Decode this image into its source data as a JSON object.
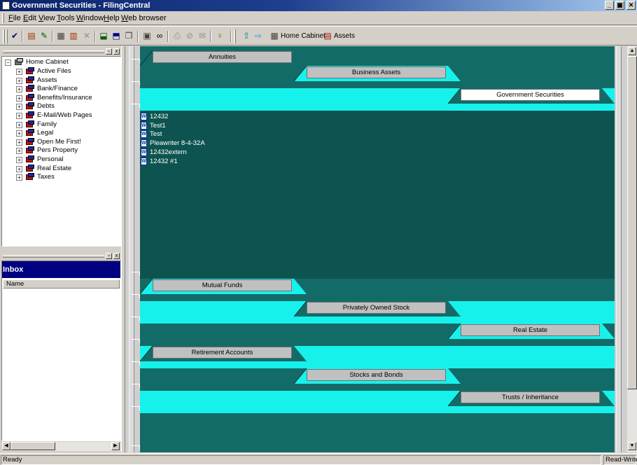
{
  "window": {
    "title": "Government Securities - FilingCentral",
    "controls": {
      "minimize": "_",
      "maximize": "▣",
      "close": "✕"
    }
  },
  "menu": [
    "File",
    "Edit",
    "View",
    "Tools",
    "Window",
    "Help",
    "Web browser"
  ],
  "toolbar": {
    "icons": [
      "checkmark-icon",
      "open-file-icon",
      "scan-icon",
      "file-cabinet-icon",
      "new-file-icon",
      "delete-x-icon",
      "import-icon",
      "export-icon",
      "copy-icon",
      "properties-icon",
      "binoculars-icon",
      "print-icon",
      "attach-icon",
      "email-icon",
      "help-key-icon"
    ],
    "nav_up_icon": "up-arrow-icon",
    "nav_forward_icon": "right-arrow-icon",
    "breadcrumb": [
      "Home Cabinet",
      "Assets"
    ]
  },
  "tree": {
    "root": "Home Cabinet",
    "items": [
      "Active Files",
      "Assets",
      "Bank/Finance",
      "Benefits/Insurance",
      "Debts",
      "E-Mail/Web Pages",
      "Family",
      "Legal",
      "Open Me First!",
      "Pers Property",
      "Personal",
      "Real Estate",
      "Taxes"
    ]
  },
  "inbox": {
    "title": "Inbox",
    "column": "Name"
  },
  "cabinet": {
    "active_drawer": "Government Securities",
    "drawers": [
      "Annuities",
      "Business Assets",
      "Government Securities",
      "Mutual Funds",
      "Privately Owned Stock",
      "Real Estate",
      "Retirement Accounts",
      "Stocks and Bonds",
      "Trusts / Inheritance"
    ],
    "files": [
      "12432",
      "Test1",
      "Test",
      "Pleawriter 8-4-32A",
      "12432extern",
      "12432 #1"
    ]
  },
  "status": {
    "left": "Ready",
    "right": "Read-Write"
  },
  "colors": {
    "dark_teal": "#136b67",
    "light_cyan": "#17f1ec",
    "deep_teal": "#0d5450",
    "title_blue": "#0a246a"
  }
}
